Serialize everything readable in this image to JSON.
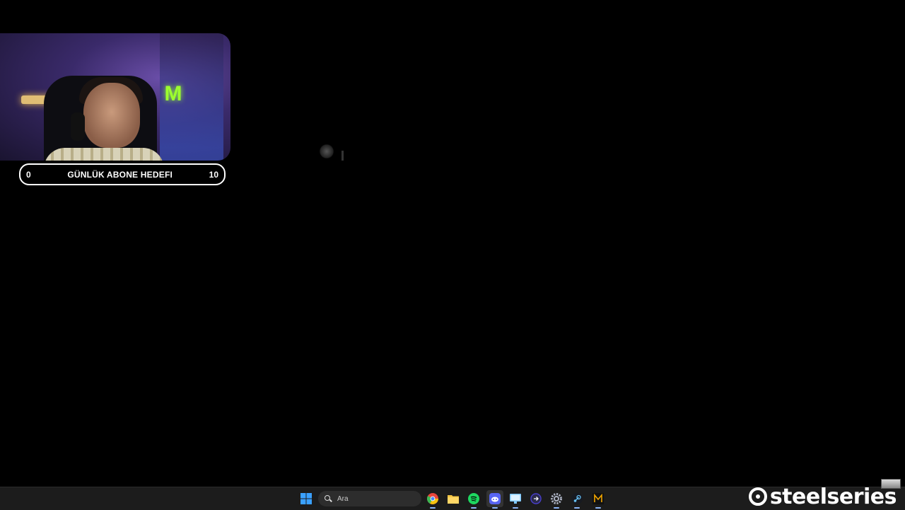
{
  "webcam": {
    "goal": {
      "current": "0",
      "title": "GÜNLÜK ABONE HEDEFI",
      "target": "10"
    }
  },
  "taskbar": {
    "search_placeholder": "Ara",
    "apps": [
      {
        "name": "start",
        "icon": "windows-icon",
        "color": "#3aa0ff"
      },
      {
        "name": "chrome",
        "icon": "chrome-icon",
        "color": "#e8453c"
      },
      {
        "name": "file-explorer",
        "icon": "folder-icon",
        "color": "#f4c542"
      },
      {
        "name": "spotify",
        "icon": "spotify-icon",
        "color": "#1ed760"
      },
      {
        "name": "discord",
        "icon": "discord-icon",
        "color": "#5865f2"
      },
      {
        "name": "monitor-app",
        "icon": "monitor-icon",
        "color": "#7fc8ff"
      },
      {
        "name": "media-app",
        "icon": "arrow-circle-icon",
        "color": "#4b3fd8"
      },
      {
        "name": "settings",
        "icon": "gear-icon",
        "color": "#aab0c0"
      },
      {
        "name": "steam",
        "icon": "steam-icon",
        "color": "#66c0f4"
      },
      {
        "name": "m-app",
        "icon": "m-letter-icon",
        "color": "#f0a500"
      }
    ],
    "overlay_brand": "steelseries"
  }
}
